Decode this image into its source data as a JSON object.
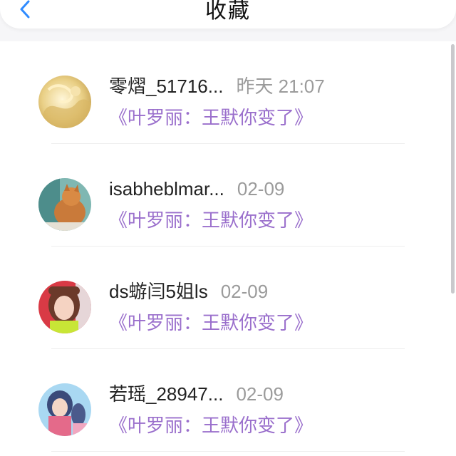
{
  "header": {
    "title": "收藏",
    "back_icon": "chevron-left-icon",
    "accent_color": "#2f8bff"
  },
  "items": [
    {
      "name": "零熠_51716...",
      "time": "昨天 21:07",
      "work": "《叶罗丽：王默你变了》"
    },
    {
      "name": "isabheblmar...",
      "time": "02-09",
      "work": "《叶罗丽：王默你变了》"
    },
    {
      "name": "ds蝣闫5姐ls",
      "time": "02-09",
      "work": "《叶罗丽：王默你变了》"
    },
    {
      "name": "若瑶_28947...",
      "time": "02-09",
      "work": "《叶罗丽：王默你变了》"
    }
  ],
  "colors": {
    "link_purple": "#9a6fcc",
    "time_gray": "#9b9b9b"
  }
}
